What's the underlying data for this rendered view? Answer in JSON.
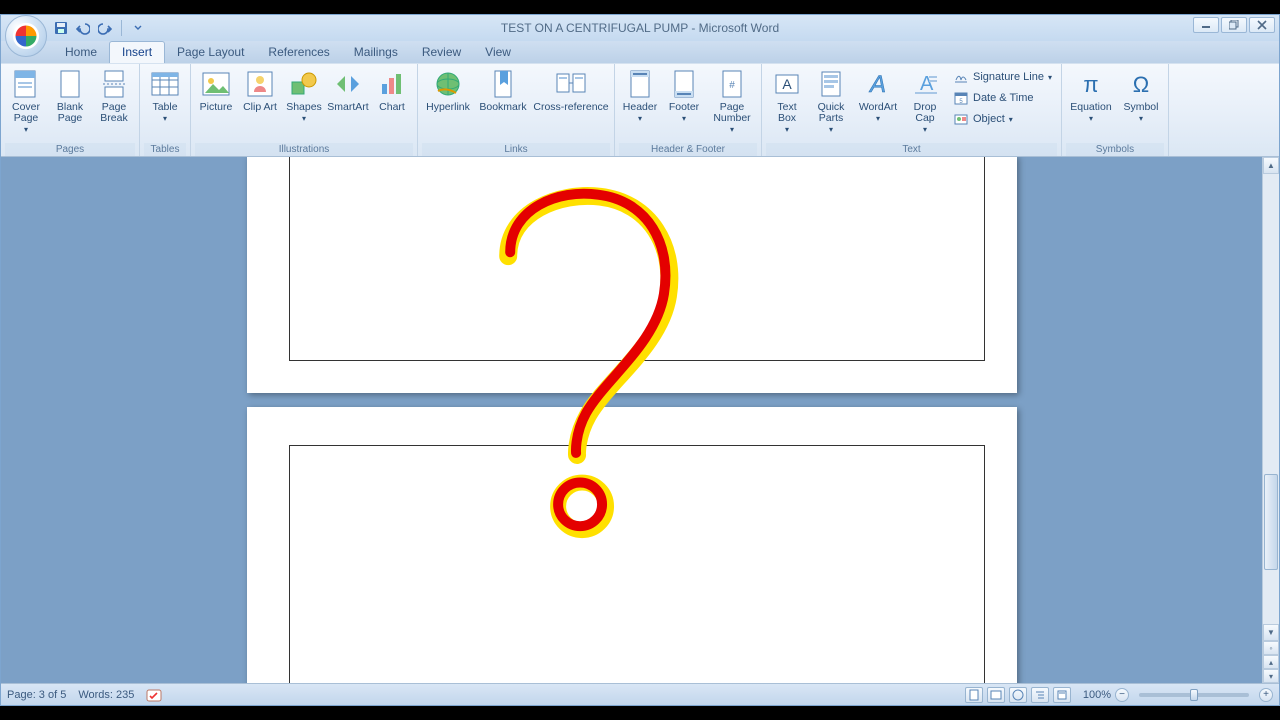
{
  "title": "TEST ON A CENTRIFUGAL PUMP - Microsoft Word",
  "tabs": [
    "Home",
    "Insert",
    "Page Layout",
    "References",
    "Mailings",
    "Review",
    "View"
  ],
  "ribbon": {
    "pages": {
      "label": "Pages",
      "items": [
        "Cover Page",
        "Blank Page",
        "Page Break"
      ]
    },
    "tables": {
      "label": "Tables",
      "items": [
        "Table"
      ]
    },
    "illustrations": {
      "label": "Illustrations",
      "items": [
        "Picture",
        "Clip Art",
        "Shapes",
        "SmartArt",
        "Chart"
      ]
    },
    "links": {
      "label": "Links",
      "items": [
        "Hyperlink",
        "Bookmark",
        "Cross-reference"
      ]
    },
    "headerfooter": {
      "label": "Header & Footer",
      "items": [
        "Header",
        "Footer",
        "Page Number"
      ]
    },
    "text": {
      "label": "Text",
      "items": [
        "Text Box",
        "Quick Parts",
        "WordArt",
        "Drop Cap",
        "Signature Line",
        "Date & Time",
        "Object"
      ]
    },
    "symbols": {
      "label": "Symbols",
      "items": [
        "Equation",
        "Symbol"
      ]
    }
  },
  "status": {
    "page": "Page: 3 of 5",
    "words": "Words: 235",
    "zoom": "100%"
  }
}
